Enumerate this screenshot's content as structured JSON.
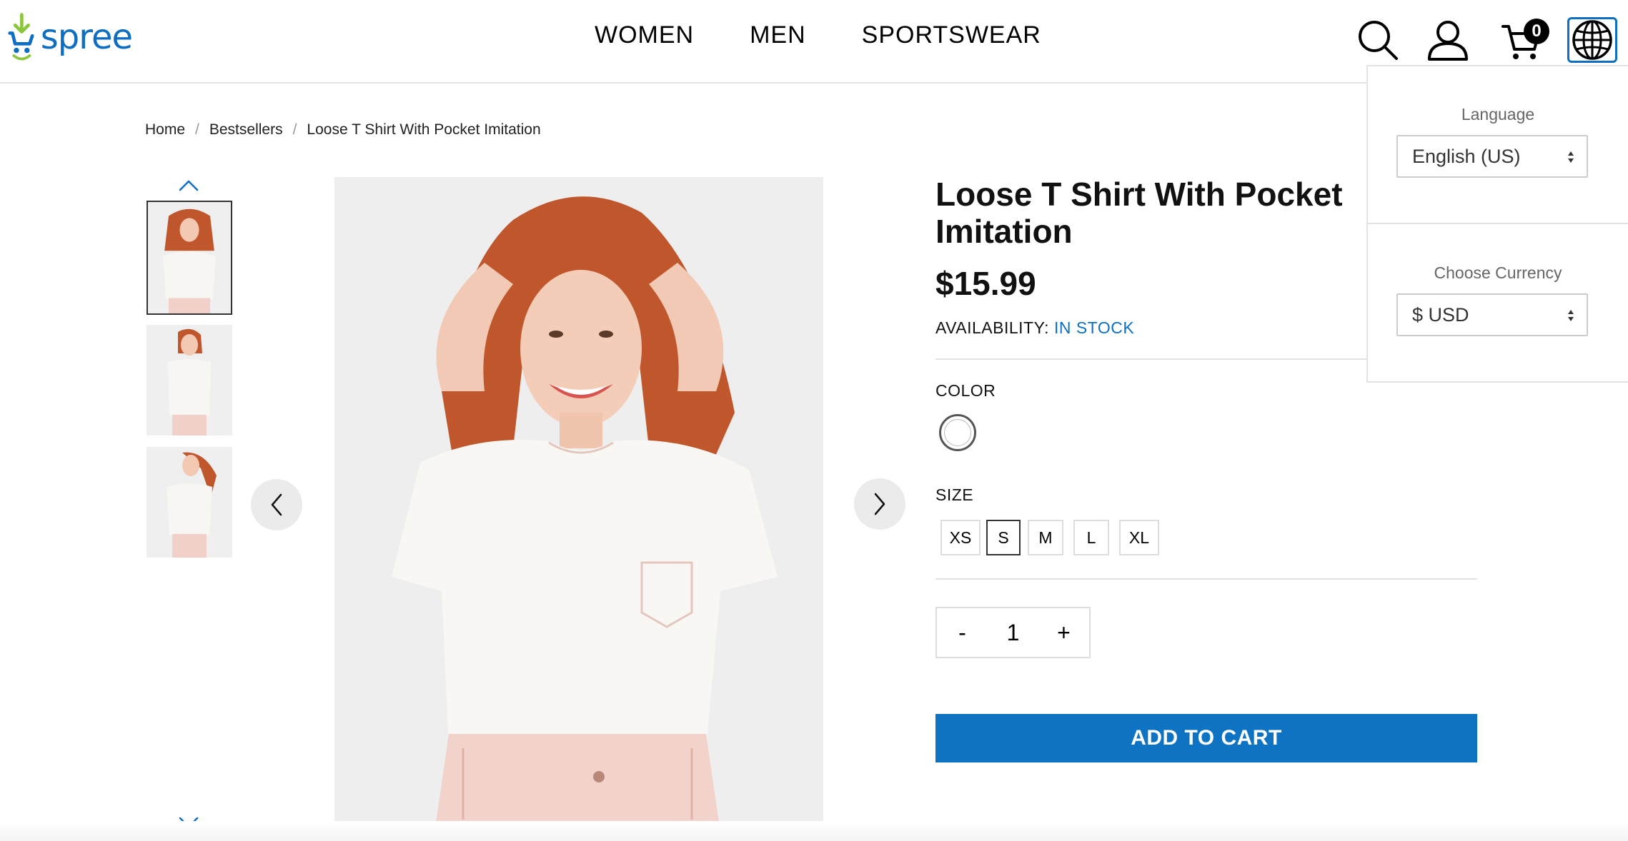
{
  "header": {
    "logo_text": "spree",
    "nav": [
      "WOMEN",
      "MEN",
      "SPORTSWEAR"
    ],
    "cart_count": "0"
  },
  "breadcrumb": [
    "Home",
    "Bestsellers",
    "Loose T Shirt With Pocket Imitation"
  ],
  "product": {
    "title": "Loose T Shirt With Pocket Imitation",
    "price": "$15.99",
    "availability_label": "AVAILABILITY:",
    "availability_value": "IN STOCK",
    "color_label": "COLOR",
    "size_label": "SIZE",
    "sizes": [
      "XS",
      "S",
      "M",
      "L",
      "XL"
    ],
    "selected_size": "S",
    "quantity": "1",
    "qty_minus": "-",
    "qty_plus": "+",
    "add_to_cart": "ADD TO CART"
  },
  "locale_dropdown": {
    "language_label": "Language",
    "language_value": "English (US)",
    "currency_label": "Choose Currency",
    "currency_value": "$ USD"
  },
  "colors": {
    "brand_blue": "#0e6fc2",
    "button_blue": "#0e73c2",
    "logo_green": "#8cc63f"
  }
}
